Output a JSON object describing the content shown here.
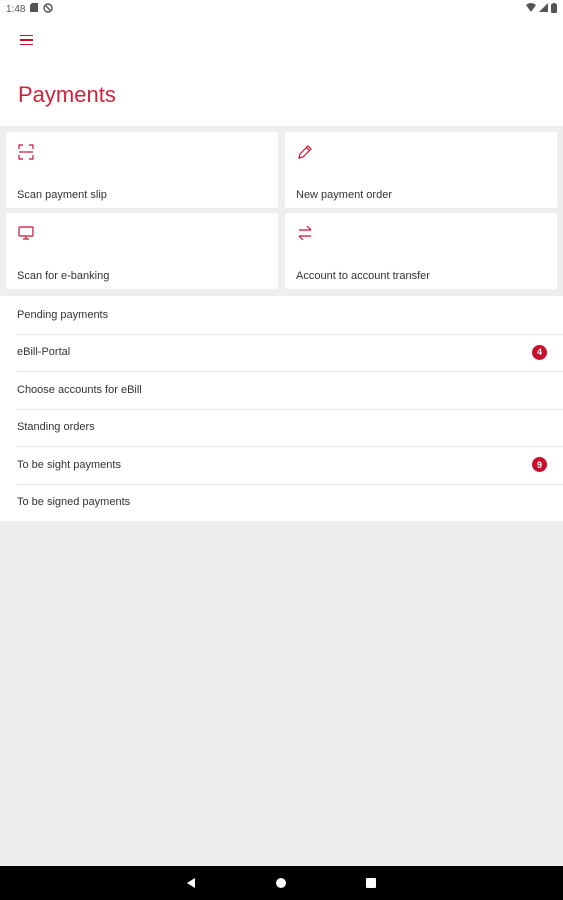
{
  "status_bar": {
    "time": "1:48"
  },
  "header": {
    "title": "Payments"
  },
  "tiles": [
    {
      "label": "Scan payment slip",
      "icon": "scan-icon"
    },
    {
      "label": "New payment order",
      "icon": "pencil-icon"
    },
    {
      "label": "Scan for e-banking",
      "icon": "monitor-icon"
    },
    {
      "label": "Account to account transfer",
      "icon": "transfer-arrows-icon"
    }
  ],
  "list": [
    {
      "label": "Pending payments",
      "badge": ""
    },
    {
      "label": "eBill-Portal",
      "badge": "4"
    },
    {
      "label": "Choose accounts for eBill",
      "badge": ""
    },
    {
      "label": "Standing orders",
      "badge": ""
    },
    {
      "label": "To be sight payments",
      "badge": "9"
    },
    {
      "label": "To be signed payments",
      "badge": ""
    }
  ],
  "colors": {
    "accent": "#c8102e",
    "background": "#eceef0",
    "surface": "#ffffff"
  }
}
